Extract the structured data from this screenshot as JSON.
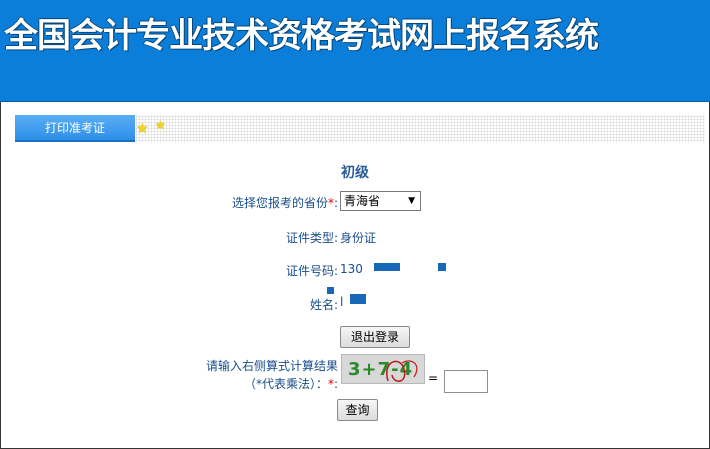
{
  "header": {
    "title": "全国会计专业技术资格考试网上报名系统"
  },
  "tab": {
    "label": "打印准考证"
  },
  "level": "初级",
  "form": {
    "province_label": "选择您报考的省份",
    "province_required": "*",
    "province_colon": ":",
    "province_value": "青海省",
    "id_type_label": "证件类型:",
    "id_type_value": "身份证",
    "id_number_label": "证件号码:",
    "id_number_visible": "130",
    "name_label": "姓名:",
    "name_visible": "l",
    "logout_label": "退出登录",
    "captcha_label_line1": "请输入右侧算式计算结果",
    "captcha_label_line2": "（*代表乘法）：",
    "captcha_required": "*",
    "captcha_colon": ":",
    "captcha_image_text": "3+7-4",
    "equals": "=",
    "query_label": "查询"
  },
  "colors": {
    "header_bg": "#0a7ed8",
    "tab_bg": "#2d8fe8",
    "label_text": "#1a4e8a",
    "required": "#dd0000",
    "captcha_text": "#2a8a2a"
  }
}
